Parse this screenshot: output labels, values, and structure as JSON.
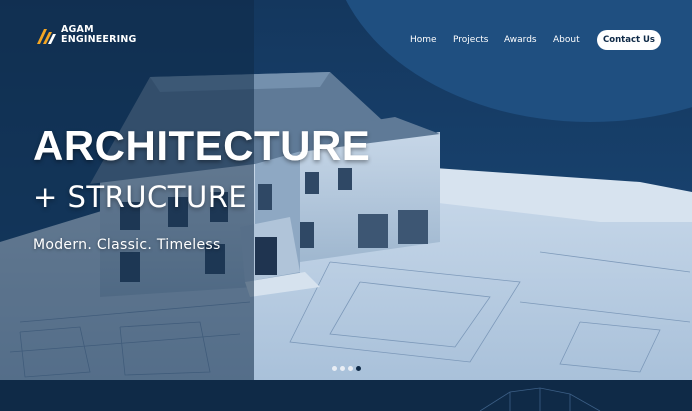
{
  "brand": {
    "name_line1": "AGAM",
    "name_line2": "ENGINEERING",
    "accent": "#f5a623"
  },
  "nav": {
    "items": [
      {
        "label": "Home"
      },
      {
        "label": "Projects"
      },
      {
        "label": "Awards"
      },
      {
        "label": "About"
      }
    ],
    "cta": "Contact Us"
  },
  "hero": {
    "title": "ARCHITECTURE",
    "subtitle": "+ STRUCTURE",
    "tagline": "Modern. Classic. Timeless",
    "image_icon": "house-on-blueprints",
    "carousel": {
      "count": 4,
      "active": 4
    }
  },
  "colors": {
    "background": "#0f2a47",
    "hero_blue": "#1b4a7a",
    "button_bg": "#ffffff"
  }
}
